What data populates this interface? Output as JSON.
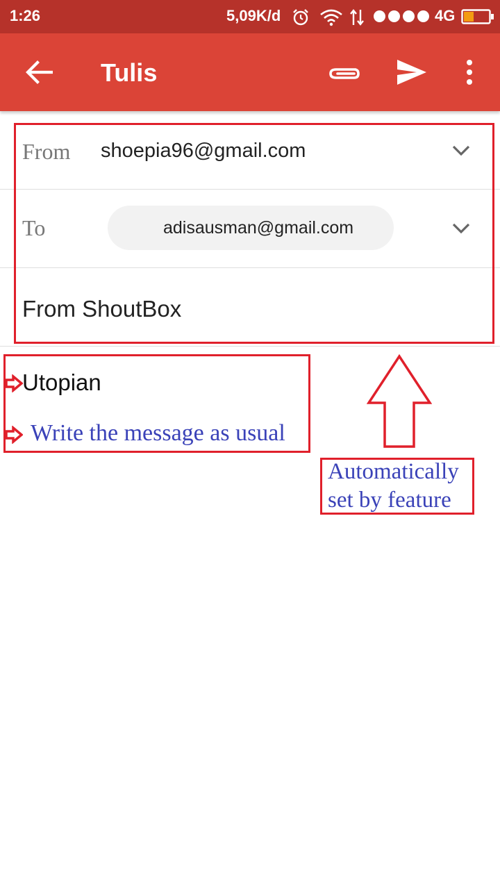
{
  "status_bar": {
    "time": "1:26",
    "speed": "5,09K/d",
    "network": "4G",
    "icons": [
      "alarm-icon",
      "wifi-icon",
      "data-activity-icon",
      "signal-icon",
      "battery-icon"
    ]
  },
  "toolbar": {
    "title": "Tulis",
    "icons": [
      "back-arrow-icon",
      "paperclip-icon",
      "send-icon",
      "more-vert-icon"
    ],
    "background": "#db4437"
  },
  "compose": {
    "from_label": "From",
    "from_value": "shoepia96@gmail.com",
    "to_label": "To",
    "to_chip": "adisausman@gmail.com",
    "subject": "From ShoutBox",
    "body": "Utopian"
  },
  "annotations": {
    "message_hint": "Write the message as usual",
    "note_line1": "Automatically",
    "note_line2": "set by feature",
    "box_color": "#e0202b",
    "text_color": "#3a42b8"
  }
}
